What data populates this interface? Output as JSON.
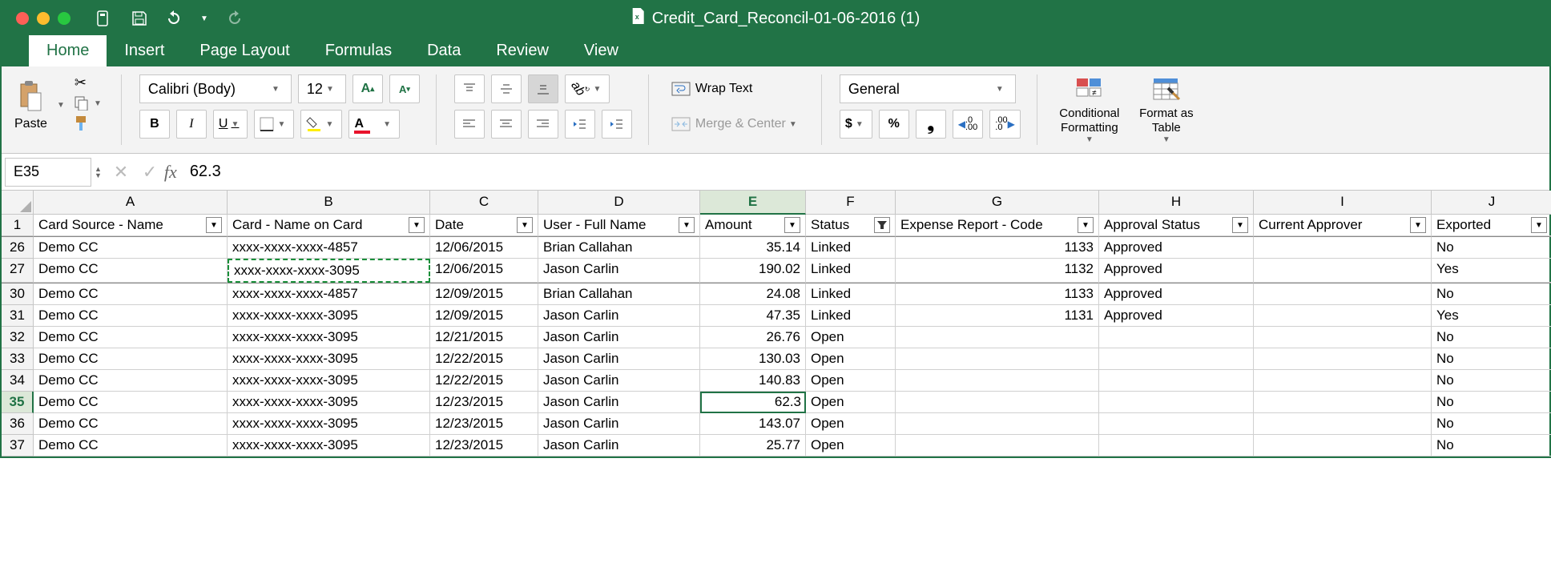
{
  "window_title": "Credit_Card_Reconcil-01-06-2016 (1)",
  "tabs": {
    "home": "Home",
    "insert": "Insert",
    "page_layout": "Page Layout",
    "formulas": "Formulas",
    "data": "Data",
    "review": "Review",
    "view": "View"
  },
  "ribbon": {
    "paste": "Paste",
    "font_name": "Calibri (Body)",
    "font_size": "12",
    "bold": "B",
    "italic": "I",
    "underline": "U",
    "wrap": "Wrap Text",
    "merge": "Merge & Center",
    "number_format": "General",
    "cond": "Conditional Formatting",
    "table": "Format as Table"
  },
  "namebox": "E35",
  "formula": "62.3",
  "columns": [
    "A",
    "B",
    "C",
    "D",
    "E",
    "F",
    "G",
    "H",
    "I",
    "J"
  ],
  "headers": {
    "A": "Card Source - Name",
    "B": "Card - Name on Card",
    "C": "Date",
    "D": "User - Full Name",
    "E": "Amount",
    "F": "Status",
    "G": "Expense Report - Code",
    "H": "Approval Status",
    "I": "Current Approver",
    "J": "Exported"
  },
  "rows": [
    {
      "n": "26",
      "A": "Demo CC",
      "B": "xxxx-xxxx-xxxx-4857",
      "C": "12/06/2015",
      "D": "Brian Callahan",
      "E": "35.14",
      "F": "Linked",
      "G": "1133",
      "H": "Approved",
      "I": "",
      "J": "No"
    },
    {
      "n": "27",
      "A": "Demo CC",
      "B": "xxxx-xxxx-xxxx-3095",
      "C": "12/06/2015",
      "D": "Jason Carlin",
      "E": "190.02",
      "F": "Linked",
      "G": "1132",
      "H": "Approved",
      "I": "",
      "J": "Yes"
    },
    {
      "n": "30",
      "A": "Demo CC",
      "B": "xxxx-xxxx-xxxx-4857",
      "C": "12/09/2015",
      "D": "Brian Callahan",
      "E": "24.08",
      "F": "Linked",
      "G": "1133",
      "H": "Approved",
      "I": "",
      "J": "No"
    },
    {
      "n": "31",
      "A": "Demo CC",
      "B": "xxxx-xxxx-xxxx-3095",
      "C": "12/09/2015",
      "D": "Jason Carlin",
      "E": "47.35",
      "F": "Linked",
      "G": "1131",
      "H": "Approved",
      "I": "",
      "J": "Yes"
    },
    {
      "n": "32",
      "A": "Demo CC",
      "B": "xxxx-xxxx-xxxx-3095",
      "C": "12/21/2015",
      "D": "Jason Carlin",
      "E": "26.76",
      "F": "Open",
      "G": "",
      "H": "",
      "I": "",
      "J": "No"
    },
    {
      "n": "33",
      "A": "Demo CC",
      "B": "xxxx-xxxx-xxxx-3095",
      "C": "12/22/2015",
      "D": "Jason Carlin",
      "E": "130.03",
      "F": "Open",
      "G": "",
      "H": "",
      "I": "",
      "J": "No"
    },
    {
      "n": "34",
      "A": "Demo CC",
      "B": "xxxx-xxxx-xxxx-3095",
      "C": "12/22/2015",
      "D": "Jason Carlin",
      "E": "140.83",
      "F": "Open",
      "G": "",
      "H": "",
      "I": "",
      "J": "No"
    },
    {
      "n": "35",
      "A": "Demo CC",
      "B": "xxxx-xxxx-xxxx-3095",
      "C": "12/23/2015",
      "D": "Jason Carlin",
      "E": "62.3",
      "F": "Open",
      "G": "",
      "H": "",
      "I": "",
      "J": "No"
    },
    {
      "n": "36",
      "A": "Demo CC",
      "B": "xxxx-xxxx-xxxx-3095",
      "C": "12/23/2015",
      "D": "Jason Carlin",
      "E": "143.07",
      "F": "Open",
      "G": "",
      "H": "",
      "I": "",
      "J": "No"
    },
    {
      "n": "37",
      "A": "Demo CC",
      "B": "xxxx-xxxx-xxxx-3095",
      "C": "12/23/2015",
      "D": "Jason Carlin",
      "E": "25.77",
      "F": "Open",
      "G": "",
      "H": "",
      "I": "",
      "J": "No"
    }
  ],
  "active_cell": {
    "row": "35",
    "col": "E"
  },
  "filter_active_col": "F"
}
